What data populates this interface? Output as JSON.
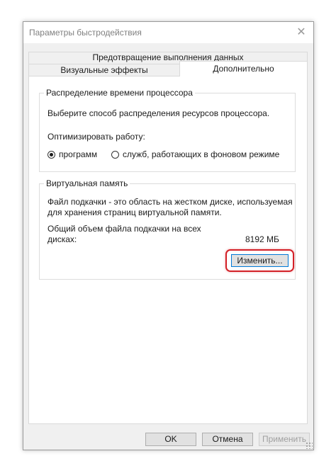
{
  "window": {
    "title": "Параметры быстродействия",
    "close_icon": "close-icon"
  },
  "tabs": {
    "dep": "Предотвращение выполнения данных",
    "visual": "Визуальные эффекты",
    "advanced": "Дополнительно",
    "selected": "Дополнительно"
  },
  "cpu": {
    "group_title": "Распределение времени процессора",
    "description": "Выберите способ распределения ресурсов процессора.",
    "optimize_label": "Оптимизировать работу:",
    "option_programs": "программ",
    "option_services": "служб, работающих в фоновом режиме",
    "selected": "программ"
  },
  "vm": {
    "group_title": "Виртуальная память",
    "desc_line1": "Файл подкачки - это область на жестком диске, используемая",
    "desc_line2": "для хранения страниц виртуальной памяти.",
    "total_line1": "Общий объем файла подкачки на всех",
    "total_line2": "дисках:",
    "total_value": "8192 МБ",
    "change_button": "Изменить..."
  },
  "buttons": {
    "ok": "OK",
    "cancel": "Отмена",
    "apply": "Применить"
  },
  "colors": {
    "highlight": "#d32027",
    "focus": "#0078d7"
  }
}
